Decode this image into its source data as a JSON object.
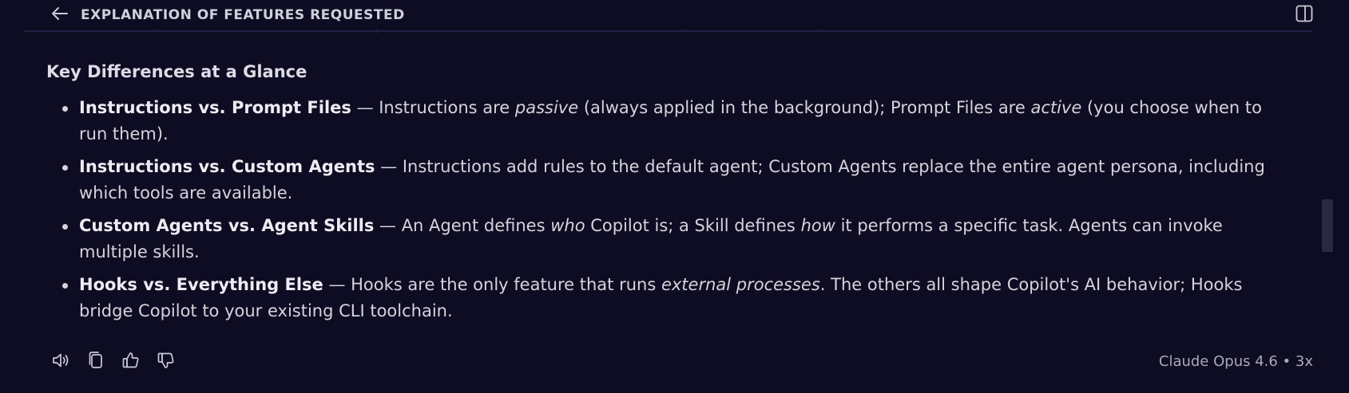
{
  "header": {
    "title": "EXPLANATION OF FEATURES REQUESTED",
    "back_icon": "arrow-left-icon",
    "split_icon": "split-panel-icon"
  },
  "section": {
    "heading": "Key Differences at a Glance",
    "items": [
      {
        "term": "Instructions vs. Prompt Files",
        "parts": [
          {
            "text": " — Instructions are ",
            "style": "normal"
          },
          {
            "text": "passive",
            "style": "italic"
          },
          {
            "text": " (always applied in the background); Prompt Files are ",
            "style": "normal"
          },
          {
            "text": "active",
            "style": "italic"
          },
          {
            "text": " (you choose when to run them).",
            "style": "normal"
          }
        ]
      },
      {
        "term": "Instructions vs. Custom Agents",
        "parts": [
          {
            "text": " — Instructions add rules to the default agent; Custom Agents replace the entire agent persona, including which tools are available.",
            "style": "normal"
          }
        ]
      },
      {
        "term": "Custom Agents vs. Agent Skills",
        "parts": [
          {
            "text": " — An Agent defines ",
            "style": "normal"
          },
          {
            "text": "who",
            "style": "italic"
          },
          {
            "text": " Copilot is; a Skill defines ",
            "style": "normal"
          },
          {
            "text": "how",
            "style": "italic"
          },
          {
            "text": " it performs a specific task. Agents can invoke multiple skills.",
            "style": "normal"
          }
        ]
      },
      {
        "term": "Hooks vs. Everything Else",
        "parts": [
          {
            "text": " — Hooks are the only feature that runs ",
            "style": "normal"
          },
          {
            "text": "external processes",
            "style": "italic"
          },
          {
            "text": ". The others all shape Copilot's AI behavior; Hooks bridge Copilot to your existing CLI toolchain.",
            "style": "normal"
          }
        ]
      }
    ]
  },
  "footer": {
    "icons": [
      "speaker-icon",
      "copy-icon",
      "thumbs-up-icon",
      "thumbs-down-icon"
    ],
    "model": "Claude Opus 4.6 • 3x"
  },
  "colors": {
    "background": "#0e0c22",
    "text": "#d4d4dc",
    "muted": "#a9a9b8"
  }
}
